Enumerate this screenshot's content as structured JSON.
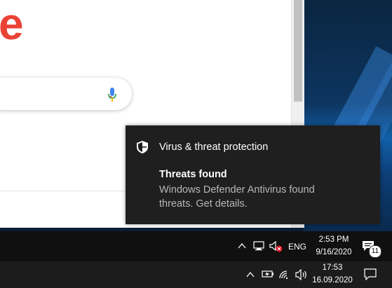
{
  "browser": {
    "logo_fragment": "e"
  },
  "notification": {
    "app": "Virus & threat protection",
    "title": "Threats found",
    "message": "Windows Defender Antivirus found threats. Get details."
  },
  "taskbar_top": {
    "language": "ENG",
    "time": "2:53 PM",
    "date": "9/16/2020",
    "badge": "11"
  },
  "taskbar_bottom": {
    "time": "17:53",
    "date": "16.09.2020"
  },
  "colors": {
    "accent_logo": "#ea4335",
    "toast_bg": "#1f1f1f",
    "taskbar": "#101010"
  }
}
